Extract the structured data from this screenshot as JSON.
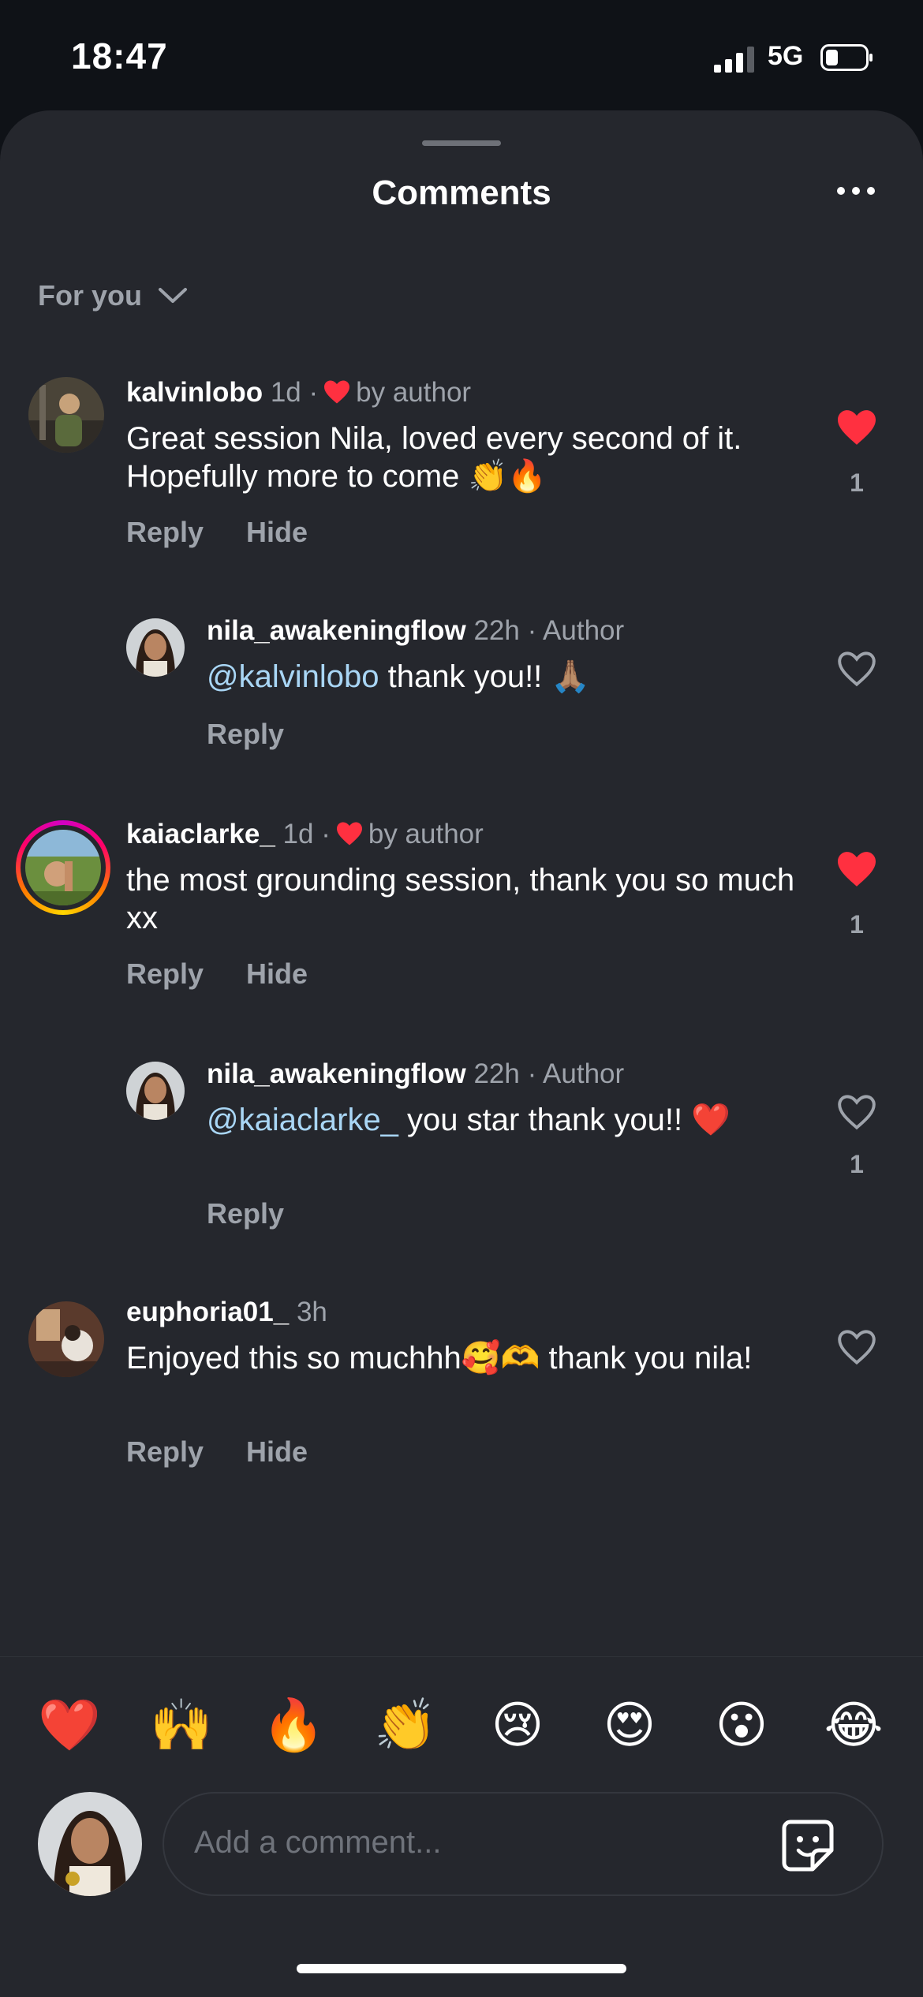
{
  "status": {
    "time": "18:47",
    "network": "5G"
  },
  "sheet": {
    "title": "Comments",
    "filter_label": "For you"
  },
  "comments": [
    {
      "user": "kalvinlobo",
      "age": "1d",
      "sep": "·",
      "badge": "by author",
      "text": "Great session Nila, loved every second of it. Hopefully more to come 👏🔥",
      "reply_label": "Reply",
      "hide_label": "Hide",
      "liked": true,
      "likes": "1"
    },
    {
      "user": "nila_awakeningflow",
      "age": "22h",
      "sep": "·",
      "badge": "Author",
      "mention": "@kalvinlobo",
      "text": " thank you!! 🙏🏽",
      "reply_label": "Reply",
      "liked": false,
      "likes": ""
    },
    {
      "user": "kaiaclarke_",
      "age": "1d",
      "sep": "·",
      "badge": "by author",
      "text": "the most grounding session, thank you so much xx",
      "reply_label": "Reply",
      "hide_label": "Hide",
      "liked": true,
      "likes": "1"
    },
    {
      "user": "nila_awakeningflow",
      "age": "22h",
      "sep": "·",
      "badge": "Author",
      "mention": "@kaiaclarke_",
      "text": " you star thank you!! ❤️",
      "reply_label": "Reply",
      "liked": false,
      "likes": "1"
    },
    {
      "user": "euphoria01_",
      "age": "3h",
      "text": "Enjoyed this so muchhh🥰🫶 thank you nila!",
      "reply_label": "Reply",
      "hide_label": "Hide",
      "liked": false,
      "likes": ""
    }
  ],
  "quick_reactions": [
    "❤️",
    "🙌",
    "🔥",
    "👏",
    "😢",
    "😍",
    "😮",
    "😂"
  ],
  "composer": {
    "placeholder": "Add a comment..."
  },
  "colors": {
    "background": "#25272d",
    "like_red": "#ff3040",
    "mention": "#a9d6f5",
    "muted": "#9ea3ab"
  }
}
